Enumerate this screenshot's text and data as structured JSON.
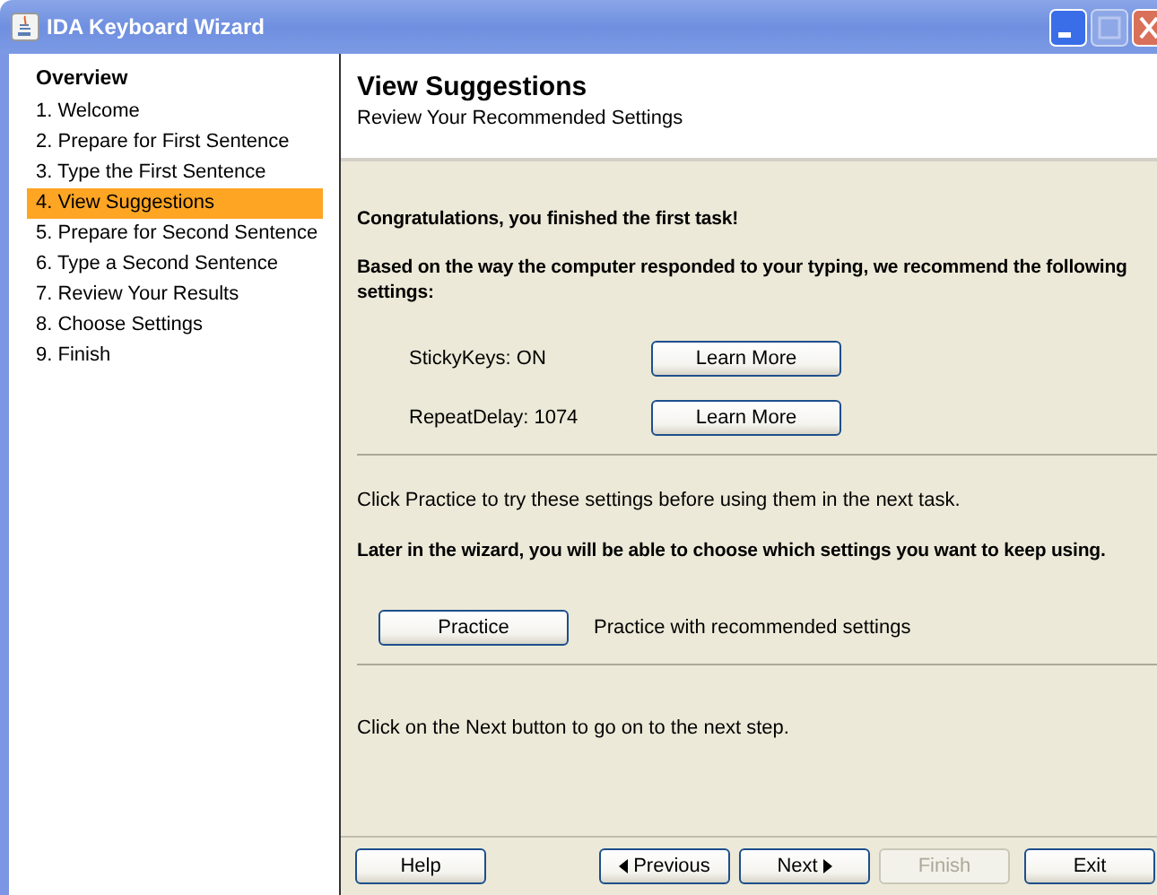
{
  "window": {
    "title": "IDA Keyboard Wizard"
  },
  "sidebar": {
    "heading": "Overview",
    "items": [
      {
        "label": "1. Welcome",
        "selected": false
      },
      {
        "label": "2. Prepare for First Sentence",
        "selected": false
      },
      {
        "label": "3. Type the First Sentence",
        "selected": false
      },
      {
        "label": "4. View Suggestions",
        "selected": true
      },
      {
        "label": "5. Prepare for Second Sentence",
        "selected": false
      },
      {
        "label": "6. Type a Second Sentence",
        "selected": false
      },
      {
        "label": "7. Review Your Results",
        "selected": false
      },
      {
        "label": "8. Choose Settings",
        "selected": false
      },
      {
        "label": "9. Finish",
        "selected": false
      }
    ]
  },
  "header": {
    "title": "View Suggestions",
    "subtitle": "Review Your Recommended Settings"
  },
  "intro": [
    {
      "text": "Congratulations, you finished the first task!",
      "bold": true
    },
    {
      "text": "Based on the way the computer responded to your typing, we recommend the following settings:",
      "bold": true
    }
  ],
  "settings": [
    {
      "label": "StickyKeys: ON",
      "button": "Learn More"
    },
    {
      "label": "RepeatDelay: 1074",
      "button": "Learn More"
    }
  ],
  "practice": {
    "notes": [
      {
        "text": "Click Practice to try these settings before using them in the next task.",
        "bold": false
      },
      {
        "text": "Later in the wizard, you will be able to choose which settings you want to keep using.",
        "bold": true
      }
    ],
    "button": "Practice",
    "caption": "Practice with recommended settings"
  },
  "next_note": "Click on the Next button to go on to the next step.",
  "buttons": [
    {
      "label": "Help",
      "disabled": false,
      "kind": "plain"
    },
    {
      "label": "Previous",
      "disabled": false,
      "kind": "back"
    },
    {
      "label": "Next",
      "disabled": false,
      "kind": "forward"
    },
    {
      "label": "Finish",
      "disabled": true,
      "kind": "plain"
    },
    {
      "label": "Exit",
      "disabled": false,
      "kind": "plain"
    }
  ]
}
